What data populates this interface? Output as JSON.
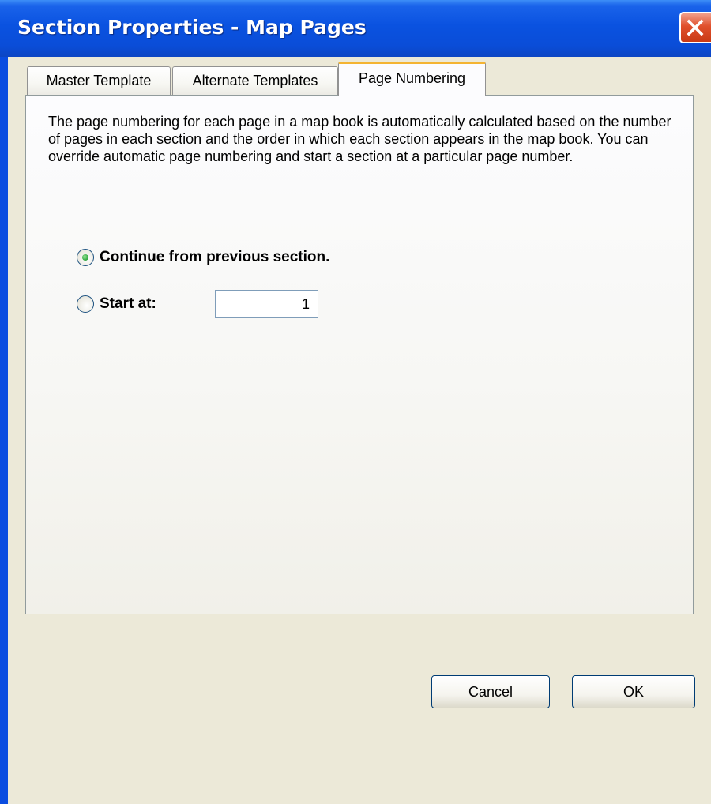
{
  "window": {
    "title": "Section Properties - Map Pages",
    "close_icon": "close-icon"
  },
  "tabs": [
    {
      "label": "Master Template",
      "active": false
    },
    {
      "label": "Alternate Templates",
      "active": false
    },
    {
      "label": "Page Numbering",
      "active": true
    }
  ],
  "page_numbering": {
    "description": "The page numbering for each page in a map book is automatically calculated based on the number of pages in each section and the order in which each section appears in the map book.  You can override automatic page numbering and start a section at a particular page number.",
    "options": [
      {
        "label": "Continue from previous section.",
        "selected": true
      },
      {
        "label": "Start at:",
        "selected": false
      }
    ],
    "start_at_value": "1"
  },
  "buttons": {
    "cancel": "Cancel",
    "ok": "OK"
  },
  "colors": {
    "titlebar": "#0a52e0",
    "dialog_background": "#ece9d8",
    "active_tab_accent": "#f4b432",
    "close_button": "#e0502c",
    "radio_selected": "#3bb24a"
  }
}
